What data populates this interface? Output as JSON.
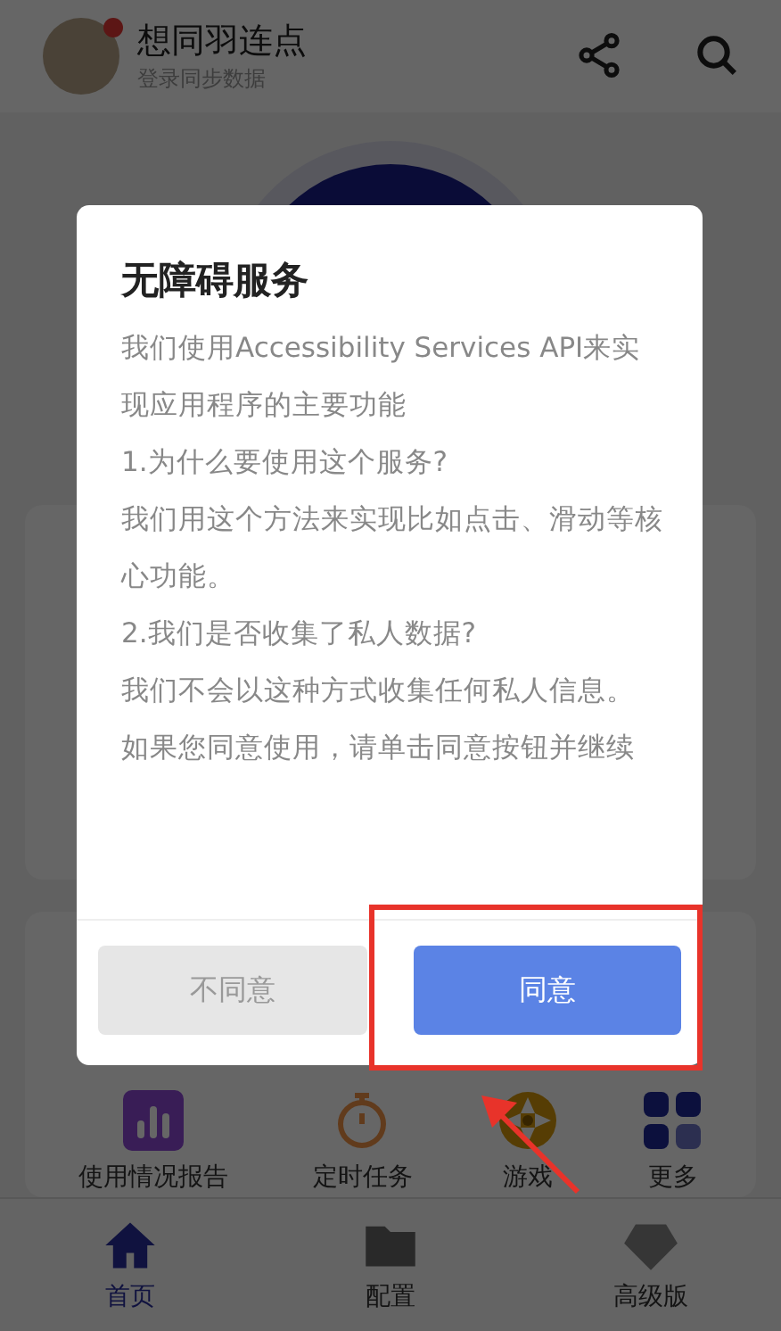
{
  "header": {
    "title": "想同羽连点",
    "subtitle": "登录同步数据",
    "notification_dot": true
  },
  "tools": [
    {
      "label": "使用情况报告",
      "kind": "chart"
    },
    {
      "label": "定时任务",
      "kind": "timer"
    },
    {
      "label": "游戏",
      "kind": "wheel"
    },
    {
      "label": "更多",
      "kind": "grid"
    }
  ],
  "bottom_nav": [
    {
      "label": "首页",
      "kind": "home",
      "selected": true
    },
    {
      "label": "配置",
      "kind": "folder",
      "selected": false
    },
    {
      "label": "高级版",
      "kind": "vip",
      "selected": false
    }
  ],
  "dialog": {
    "title": "无障碍服务",
    "paragraphs": [
      "我们使用Accessibility Services API来实现应用程序的主要功能",
      "1.为什么要使用这个服务?",
      "我们用这个方法来实现比如点击、滑动等核心功能。",
      "2.我们是否收集了私人数据?",
      "我们不会以这种方式收集任何私人信息。",
      "如果您同意使用，请单击同意按钮并继续"
    ],
    "buttons": [
      {
        "label": "不同意",
        "kind": "secondary"
      },
      {
        "label": "同意",
        "kind": "primary"
      }
    ]
  }
}
